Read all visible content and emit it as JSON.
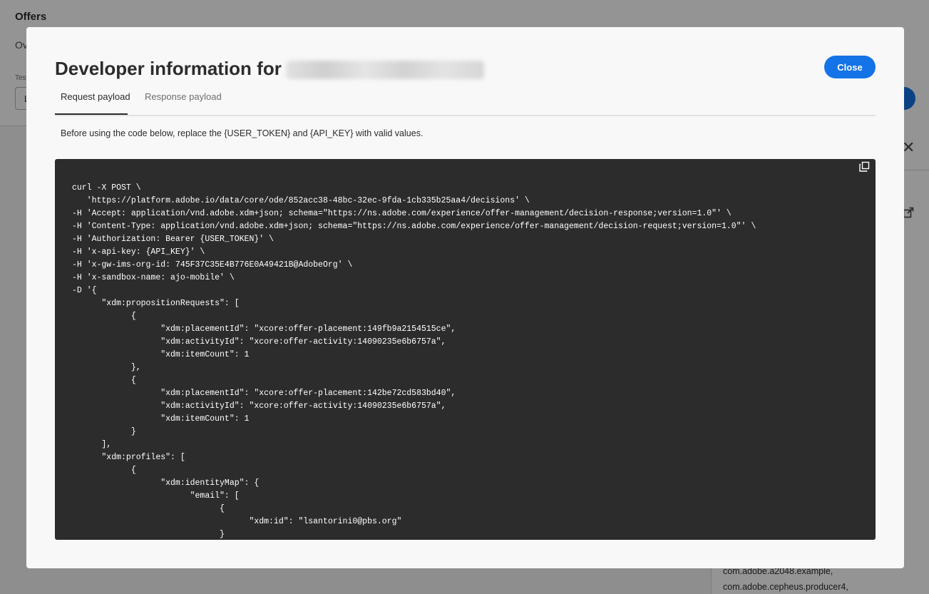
{
  "app": {
    "title": "Offers",
    "tab_partial": "Ov",
    "field_label_partial": "Test",
    "field_value_partial": "L",
    "side_panel": {
      "close_icon": "close-icon",
      "lines": [
        "com.adobe.a2048.example,",
        "com.adobe.cepheus.producer4,"
      ]
    },
    "accent_color": "#1473e6"
  },
  "dialog": {
    "title_prefix": "Developer information for",
    "close_label": "Close",
    "tabs": [
      {
        "label": "Request payload",
        "active": true
      },
      {
        "label": "Response payload",
        "active": false
      }
    ],
    "instructions": "Before using the code below, replace the {USER_TOKEN} and {API_KEY} with valid values.",
    "copy_icon": "copy-icon",
    "code_lines": [
      "curl -X POST \\",
      "   'https://platform.adobe.io/data/core/ode/852acc38-48bc-32ec-9fda-1cb335b25aa4/decisions' \\",
      "-H 'Accept: application/vnd.adobe.xdm+json; schema=\"https://ns.adobe.com/experience/offer-management/decision-response;version=1.0\"' \\",
      "-H 'Content-Type: application/vnd.adobe.xdm+json; schema=\"https://ns.adobe.com/experience/offer-management/decision-request;version=1.0\"' \\",
      "-H 'Authorization: Bearer {USER_TOKEN}' \\",
      "-H 'x-api-key: {API_KEY}' \\",
      "-H 'x-gw-ims-org-id: 745F37C35E4B776E0A49421B@AdobeOrg' \\",
      "-H 'x-sandbox-name: ajo-mobile' \\",
      "-D '{",
      "      \"xdm:propositionRequests\": [",
      "            {",
      "                  \"xdm:placementId\": \"xcore:offer-placement:149fb9a2154515ce\",",
      "                  \"xdm:activityId\": \"xcore:offer-activity:14090235e6b6757a\",",
      "                  \"xdm:itemCount\": 1",
      "            },",
      "            {",
      "                  \"xdm:placementId\": \"xcore:offer-placement:142be72cd583bd40\",",
      "                  \"xdm:activityId\": \"xcore:offer-activity:14090235e6b6757a\",",
      "                  \"xdm:itemCount\": 1",
      "            }",
      "      ],",
      "      \"xdm:profiles\": [",
      "            {",
      "                  \"xdm:identityMap\": {",
      "                        \"email\": [",
      "                              {",
      "                                    \"xdm:id\": \"lsantorini0@pbs.org\"",
      "                              }"
    ]
  }
}
